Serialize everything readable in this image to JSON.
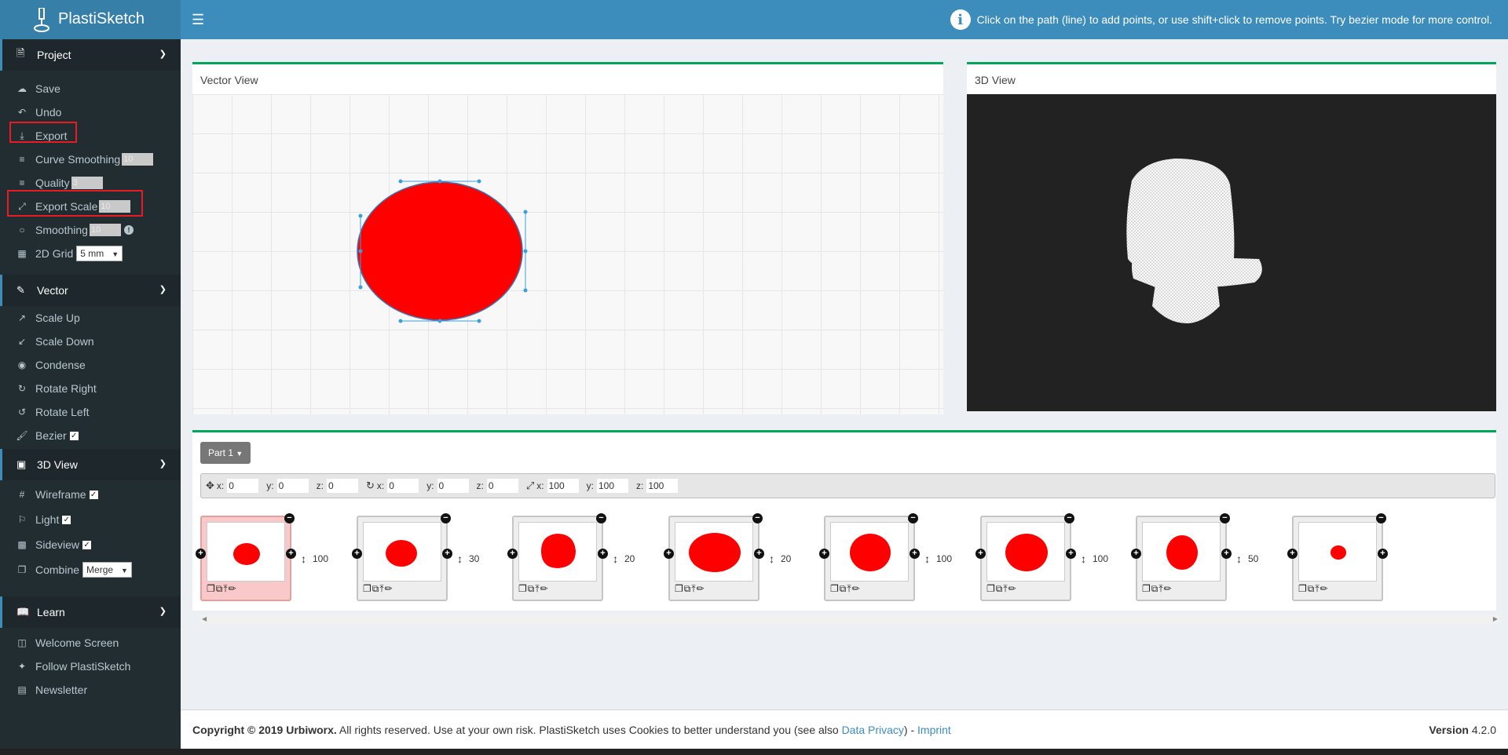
{
  "app": {
    "title": "PlastiSketch",
    "notice": "Click on the path (line) to add points, or use shift+click to remove points. Try bezier mode for more control."
  },
  "sidebar": {
    "project": {
      "title": "Project",
      "save": "Save",
      "undo": "Undo",
      "export": "Export",
      "curve_smoothing": "Curve Smoothing",
      "curve_smoothing_val": "10",
      "quality": "Quality",
      "quality_val": "3",
      "export_scale": "Export Scale",
      "export_scale_val": "10",
      "smoothing": "Smoothing",
      "smoothing_val": "10",
      "grid": "2D Grid",
      "grid_val": "5 mm"
    },
    "vector": {
      "title": "Vector",
      "scale_up": "Scale Up",
      "scale_down": "Scale Down",
      "condense": "Condense",
      "rotate_right": "Rotate Right",
      "rotate_left": "Rotate Left",
      "bezier": "Bezier"
    },
    "view3d": {
      "title": "3D View",
      "wireframe": "Wireframe",
      "light": "Light",
      "sideview": "Sideview",
      "combine": "Combine",
      "combine_val": "Merge"
    },
    "learn": {
      "title": "Learn",
      "welcome": "Welcome Screen",
      "follow": "Follow PlastiSketch",
      "newsletter": "Newsletter"
    }
  },
  "vector_view": {
    "title": "Vector View"
  },
  "view_3d": {
    "title": "3D View"
  },
  "parts": {
    "button": "Part 1",
    "toolbar": {
      "pos": [
        {
          "label": "x:",
          "value": "0"
        },
        {
          "label": "y:",
          "value": "0"
        },
        {
          "label": "z:",
          "value": "0"
        }
      ],
      "rot": [
        {
          "label": "x:",
          "value": "0"
        },
        {
          "label": "y:",
          "value": "0"
        },
        {
          "label": "z:",
          "value": "0"
        }
      ],
      "scale": [
        {
          "label": "x:",
          "value": "100"
        },
        {
          "label": "y:",
          "value": "100"
        },
        {
          "label": "z:",
          "value": "100"
        }
      ]
    },
    "heights": [
      "100",
      "30",
      "20",
      "20",
      "100",
      "100",
      "50"
    ]
  },
  "footer": {
    "copyright": "Copyright © 2019 Urbiworx.",
    "text": " All rights reserved. Use at your own risk. PlastiSketch uses Cookies to better understand you (see also ",
    "privacy": "Data Privacy",
    "sep": ") - ",
    "imprint": "Imprint",
    "version_label": "Version",
    "version": "4.2.0"
  },
  "colors": {
    "accent": "#3c8dbc",
    "sidebar": "#222d32",
    "shape": "#ff0000",
    "panel_border": "#00a65a"
  }
}
